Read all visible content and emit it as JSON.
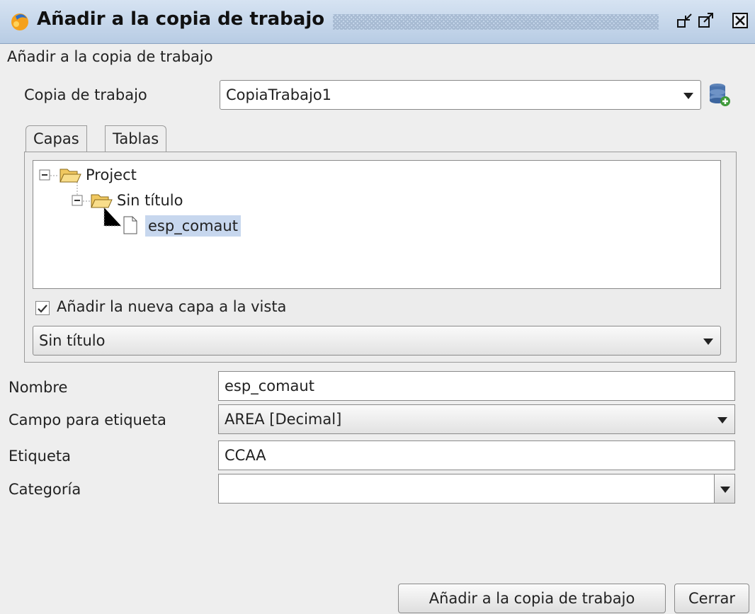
{
  "window": {
    "title": "Añadir a la copia de trabajo",
    "controls": [
      "minimize-icon",
      "maximize-icon",
      "close-icon"
    ]
  },
  "subtitle": "Añadir a la copia de trabajo",
  "working_copy": {
    "label": "Copia de trabajo",
    "value": "CopiaTrabajo1",
    "add_icon": "database-add-icon"
  },
  "tabs": [
    {
      "label": "Capas",
      "active": true
    },
    {
      "label": "Tablas",
      "active": false
    }
  ],
  "tree": {
    "root": "Project",
    "child": "Sin título",
    "leaf": "esp_comaut"
  },
  "add_to_view": {
    "label": "Añadir la nueva capa a la vista",
    "checked": true
  },
  "view_select": {
    "value": "Sin título"
  },
  "fields": {
    "nombre_label": "Nombre",
    "nombre_value": "esp_comaut",
    "campo_label": "Campo para etiqueta",
    "campo_value": "AREA [Decimal]",
    "etiqueta_label": "Etiqueta",
    "etiqueta_value": "CCAA",
    "categoria_label": "Categoría",
    "categoria_value": ""
  },
  "buttons": {
    "add": "Añadir a la copia de trabajo",
    "close": "Cerrar"
  },
  "colors": {
    "titlebar": "#c4d4ea",
    "selection": "#c7d7ee"
  }
}
